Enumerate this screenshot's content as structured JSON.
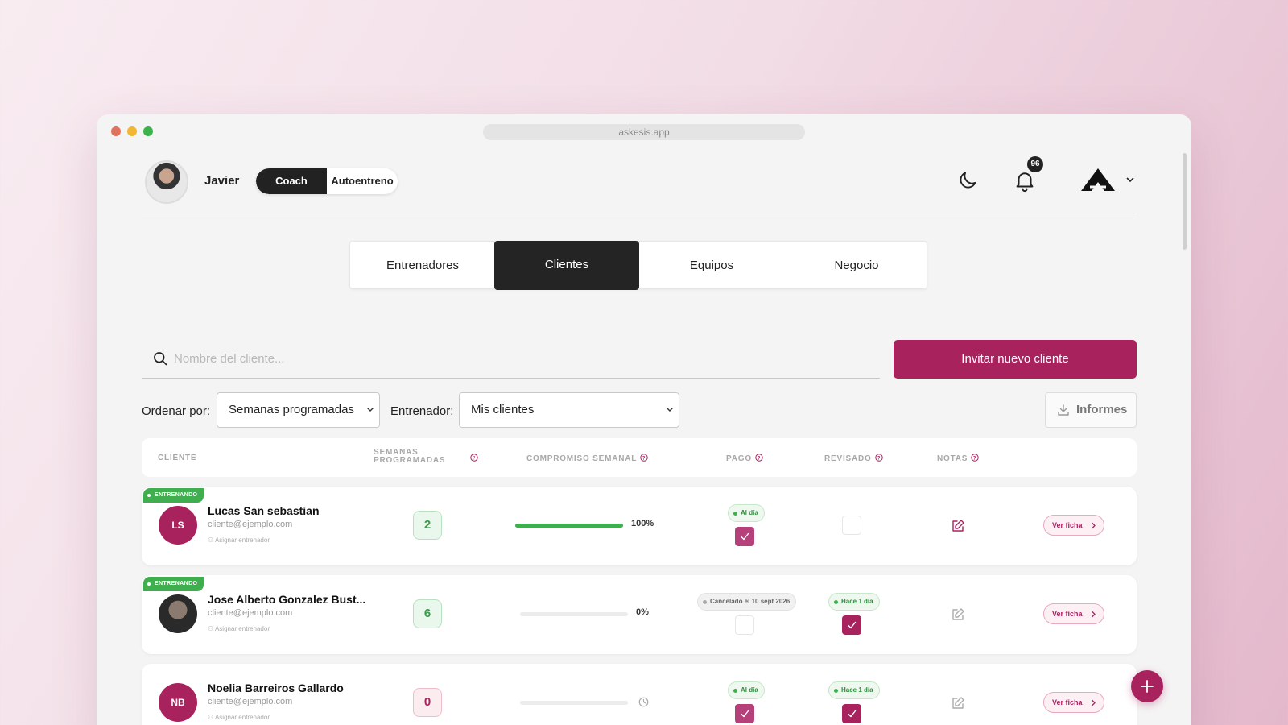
{
  "browser": {
    "url": "askesis.app"
  },
  "header": {
    "user_name": "Javier",
    "mode_toggle": {
      "active": "Coach",
      "inactive": "Autoentreno"
    },
    "notifications_count": "96"
  },
  "tabs": [
    {
      "label": "Entrenadores",
      "active": false
    },
    {
      "label": "Clientes",
      "active": true
    },
    {
      "label": "Equipos",
      "active": false
    },
    {
      "label": "Negocio",
      "active": false
    }
  ],
  "search": {
    "placeholder": "Nombre del cliente...",
    "value": ""
  },
  "invite_button": "Invitar nuevo cliente",
  "filters": {
    "sort_label": "Ordenar por:",
    "sort_value": "Semanas programadas",
    "trainer_label": "Entrenador:",
    "trainer_value": "Mis clientes"
  },
  "reports_button": "Informes",
  "table": {
    "headers": {
      "client": "CLIENTE",
      "weeks_line1": "SEMANAS",
      "weeks_line2": "PROGRAMADAS",
      "commitment": "COMPROMISO SEMANAL",
      "payment": "PAGO",
      "reviewed": "REVISADO",
      "notes": "NOTAS"
    },
    "rows": [
      {
        "status": "ENTRENANDO",
        "initials": "LS",
        "name": "Lucas San sebastian",
        "email": "cliente@ejemplo.com",
        "assign": "Asignar entrenador",
        "weeks": "2",
        "commitment_pct": "100%",
        "commitment_value": 1.0,
        "payment_pill": "Al día",
        "payment_checked": true,
        "reviewed_pill": "",
        "reviewed_checked": false,
        "ficha": "Ver ficha"
      },
      {
        "status": "ENTRENANDO",
        "initials": "",
        "name": "Jose Alberto Gonzalez Bust...",
        "email": "cliente@ejemplo.com",
        "assign": "Asignar entrenador",
        "weeks": "6",
        "commitment_pct": "0%",
        "commitment_value": 0.0,
        "payment_pill": "Cancelado el 10 sept 2026",
        "payment_checked": false,
        "reviewed_pill": "Hace 1 día",
        "reviewed_checked": true,
        "ficha": "Ver ficha"
      },
      {
        "status": "",
        "initials": "NB",
        "name": "Noelia Barreiros Gallardo",
        "email": "cliente@ejemplo.com",
        "assign": "Asignar entrenador",
        "weeks": "0",
        "commitment_pct": "",
        "commitment_value": 0.0,
        "payment_pill": "Al día",
        "payment_checked": true,
        "reviewed_pill": "Hace 1 día",
        "reviewed_checked": true,
        "ficha": "Ver ficha"
      }
    ]
  },
  "colors": {
    "brand": "#a8235e",
    "success": "#3fae4e",
    "dark": "#242424"
  }
}
